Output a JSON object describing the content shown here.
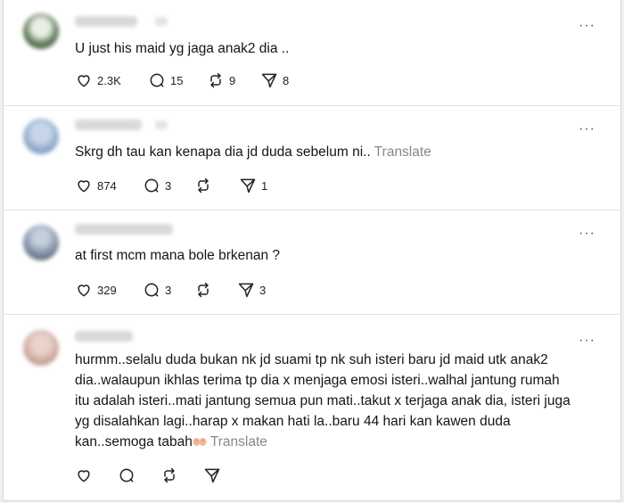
{
  "posts": [
    {
      "text": "U just his maid yg jaga anak2 dia ..",
      "translate": "",
      "likes": "2.3K",
      "replies": "15",
      "reposts": "9",
      "shares": "8",
      "avatar_color": "#5f7f5a"
    },
    {
      "text": "Skrg dh tau kan kenapa dia jd duda sebelum ni..",
      "translate": "Translate",
      "likes": "874",
      "replies": "3",
      "reposts": "",
      "shares": "1",
      "avatar_color": "#8aa6c9"
    },
    {
      "text": "at first mcm mana bole brkenan ?",
      "translate": "",
      "likes": "329",
      "replies": "3",
      "reposts": "",
      "shares": "3",
      "avatar_color": "#7d8da3"
    },
    {
      "lines": [
        "hurmm..selalu duda bukan nk jd suami tp nk suh isteri baru jd maid utk anak2",
        "dia..walaupun ikhlas terima tp dia x menjaga emosi isteri..walhal jantung rumah",
        "itu adalah isteri..mati jantung semua pun mati..takut x terjaga anak dia, isteri juga",
        "yg disalahkan lagi..harap x makan hati la..baru 44 hari kan kawen duda",
        "kan..semoga tabah"
      ],
      "translate": "Translate",
      "likes": "",
      "replies": "",
      "reposts": "",
      "shares": "",
      "avatar_color": "#c9a49a"
    }
  ],
  "more_label": "···",
  "icons": {
    "like": "heart-icon",
    "reply": "comment-icon",
    "repost": "repost-icon",
    "share": "share-icon",
    "emoji": "hands-emoji"
  }
}
